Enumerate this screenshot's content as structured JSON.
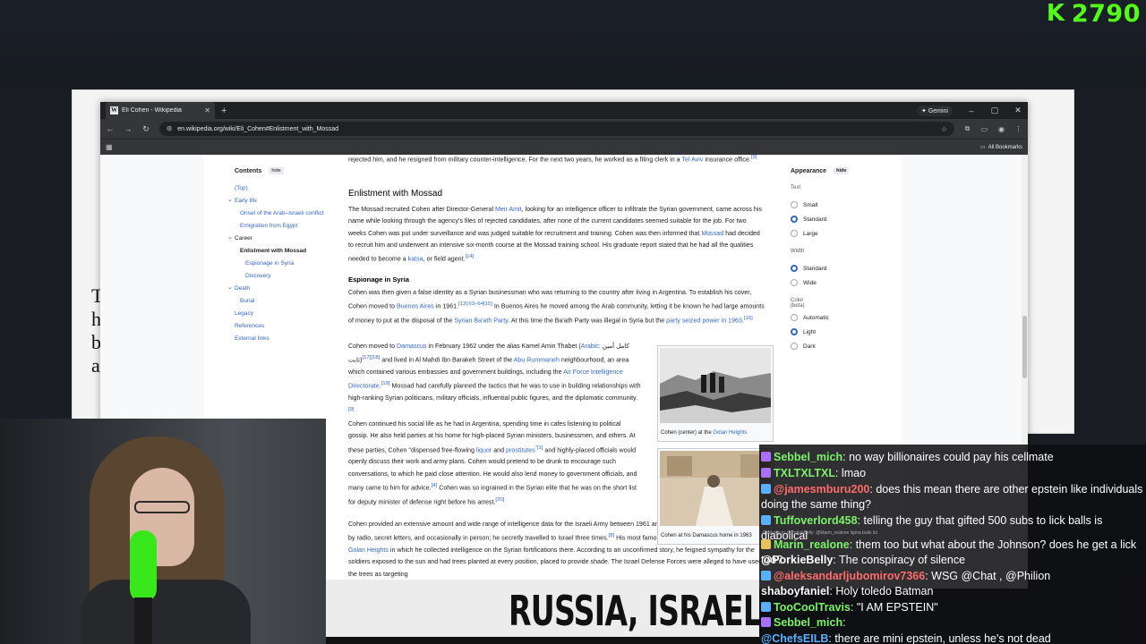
{
  "stream": {
    "kick_count": "2790",
    "banner_text": "RUSSIA, ISRAEL,",
    "colors": {
      "kick_green": "#53fc18"
    }
  },
  "browser": {
    "tab_title": "Eli Cohen - Wikipedia",
    "gemini_label": "Gemini",
    "url": "en.wikipedia.org/wiki/Eli_Cohen#Enlistment_with_Mossad",
    "all_bookmarks": "All Bookmarks"
  },
  "toc": {
    "title": "Contents",
    "hide": "hide",
    "items": [
      "(Top)",
      "Early life",
      "Onset of the Arab–Israeli conflict",
      "Emigration from Egypt",
      "Career",
      "Enlistment with Mossad",
      "Espionage in Syria",
      "Discovery",
      "Death",
      "Burial",
      "Legacy",
      "References",
      "External links"
    ]
  },
  "article": {
    "intro_a": "rejected him, and he resigned from military counter-intelligence. For the next two years, he worked as a filing clerk in a ",
    "intro_link": "Tel Aviv",
    "intro_b": " insurance office.",
    "intro_ref": "[9]",
    "h_mossad": "Enlistment with Mossad",
    "p1_a": "The Mossad recruited Cohen after Director-General ",
    "p1_link1": "Meir Amit",
    "p1_b": ", looking for an intelligence officer to infiltrate the Syrian government, came across his name while looking through the agency's files of rejected candidates, after none of the current candidates seemed suitable for the job. For two weeks Cohen was put under surveillance and was judged suitable for recruitment and training. Cohen was then informed that ",
    "p1_link2": "Mossad",
    "p1_c": " had decided to recruit him and underwent an intensive six-month course at the Mossad training school. His graduate report stated that he had all the qualities needed to become a ",
    "p1_link3": "katsa",
    "p1_d": ", or field agent.",
    "p1_ref": "[14]",
    "h_espionage": "Espionage in Syria",
    "p2_a": "Cohen was then given a false identity as a Syrian businessman who was returning to the country after living in Argentina. To establish his cover, Cohen moved to ",
    "p2_link1": "Buenos Aires",
    "p2_b": " in 1961.",
    "p2_ref1": "[13]:63–64[15]",
    "p2_c": " In Buenos Aires he moved among the Arab community, letting it be known he had large amounts of money to put at the disposal of the ",
    "p2_link2": "Syrian Ba'ath Party",
    "p2_d": ". At this time the Ba'ath Party was illegal in Syria but the ",
    "p2_link3": "party seized power in 1963",
    "p2_e": ".",
    "p2_ref2": "[16]",
    "p3_a": "Cohen moved to ",
    "p3_link1": "Damascus",
    "p3_b": " in February 1962 under the alias Kamel Amin Thabet (",
    "p3_link2": "Arabic",
    "p3_c": ": كامل أمين ثابت)",
    "p3_ref1": "[17][18]",
    "p3_d": " and lived in Al Mahdi Ibn Barakeh Street of the ",
    "p3_link3": "Abu Rummaneh",
    "p3_e": " neighbourhood, an area which contained various embassies and government buildings, including the ",
    "p3_link4": "Air Force Intelligence Directorate",
    "p3_f": ".",
    "p3_ref2": "[19]",
    "p3_g": " Mossad had carefully planned the tactics that he was to use in building relationships with high-ranking Syrian politicians, military officials, influential public figures, and the diplomatic community.",
    "p3_ref3": "[9]",
    "p4_a": "Cohen continued his social life as he had in Argentina, spending time in cafes listening to political gossip. He also held parties at his home for high-placed Syrian ministers, businessmen, and others. At these parties, Cohen \"dispensed free-flowing ",
    "p4_link1": "liquor",
    "p4_b": " and ",
    "p4_link2": "prostitutes",
    "p4_ref1": "\"[1]",
    "p4_c": " and highly-placed officials would openly discuss their work and army plans. Cohen would pretend to be drunk to encourage such conversations, to which he paid close attention. He would also lend money to government officials, and many came to him for advice.",
    "p4_ref2": "[4]",
    "p4_d": " Cohen was so ingrained in the Syrian elite that he was on the short list for deputy minister of defense right before his arrest.",
    "p4_ref3": "[20]",
    "p5_a": "Cohen provided an extensive amount and wide range of intelligence data for the Israeli Army between 1961 and 1965. He sent intelligence to Israel by radio, secret letters, and occasionally in person; he secretly travelled to Israel three times.",
    "p5_ref1": "[8]",
    "p5_b": " His most famous achievement was the tour of the ",
    "p5_link1": "Golan Heights",
    "p5_c": " in which he collected intelligence on the Syrian fortifications there. According to an unconfirmed story, he feigned sympathy for the soldiers exposed to the sun and had trees planted at every position, placed to provide shade. The Israel Defense Forces were alleged to have used the trees as targeting",
    "fig1_cap_a": "Cohen (center) at the ",
    "fig1_cap_link": "Golan Heights",
    "fig2_cap": "Cohen at his Damascus home in 1963"
  },
  "appearance": {
    "title": "Appearance",
    "hide": "hide",
    "text_label": "Text",
    "text_options": [
      "Small",
      "Standard",
      "Large"
    ],
    "text_selected": 1,
    "width_label": "Width",
    "width_options": [
      "Standard",
      "Wide"
    ],
    "width_selected": 0,
    "color_label": "Color (beta)",
    "color_options": [
      "Automatic",
      "Light",
      "Dark"
    ],
    "color_selected": 1
  },
  "chat": [
    {
      "user": "Sebbel_mich",
      "color": "#7cf26a",
      "text": ": no way billionaires could pay his cellmate",
      "badge": "#a970ff"
    },
    {
      "user": "TXLTXLTXL",
      "color": "#7cf26a",
      "text": ": lmao",
      "badge": "#a970ff"
    },
    {
      "user": "@jamesmburu200",
      "color": "#ff6b6b",
      "text": ": does this mean there are other epstein like individuals doing the same thing?",
      "badge": "#5ab0ff"
    },
    {
      "user": "Tuffoverlord458",
      "color": "#7cf26a",
      "text": ": telling the guy that gifted 500 subs to lick balls is diabolical",
      "badge": "#5ab0ff"
    },
    {
      "reply": "Replying to @PorkieBelly: @Marin_realone ligma balls lol"
    },
    {
      "user": "Marin_realone",
      "color": "#7cf26a",
      "text": ": them too but what about the Johnson? does he get a lick too?",
      "badge": "#e8c35a"
    },
    {
      "user": "@PorkieBelly",
      "color": "#ffffff",
      "text": ": The conspiracy of silence",
      "badge": ""
    },
    {
      "user": "@aleksandarljubomirov7366",
      "color": "#ff6b6b",
      "text": ": WSG @Chat , @Philion",
      "badge": "#5ab0ff"
    },
    {
      "user": "shaboyfaniel",
      "color": "#ffffff",
      "text": ": Holy toledo Batman",
      "badge": ""
    },
    {
      "user": "TooCoolTravis",
      "color": "#7cf26a",
      "text": ": \"I AM EPSTEIN\"",
      "badge": "#5ab0ff"
    },
    {
      "user": "Sebbel_mich",
      "color": "#7cf26a",
      "text": ":",
      "badge": "#a970ff"
    },
    {
      "user": "@ChefsEILB",
      "color": "#5ab0ff",
      "text": ": there are mini epstein, unless he's not dead",
      "badge": ""
    }
  ]
}
